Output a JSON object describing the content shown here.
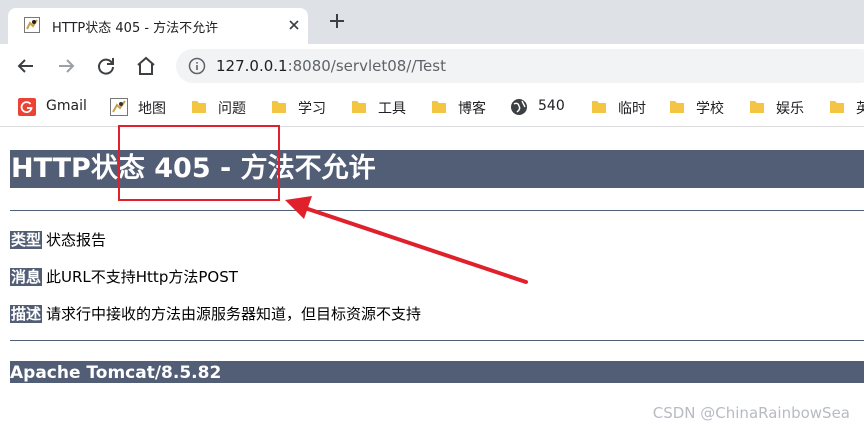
{
  "tab": {
    "title": "HTTP状态 405 - 方法不允许",
    "favicon": "tomcat-icon"
  },
  "toolbar": {
    "url_host": "127.0.0.1",
    "url_rest": ":8080/servlet08//Test",
    "icons": [
      "back-icon",
      "forward-icon",
      "reload-icon",
      "home-icon",
      "info-icon"
    ]
  },
  "bookmarks": [
    {
      "label": "Gmail",
      "icon": "gmail-icon"
    },
    {
      "label": "地图",
      "icon": "map-icon"
    },
    {
      "label": "问题",
      "icon": "folder-icon"
    },
    {
      "label": "学习",
      "icon": "folder-icon"
    },
    {
      "label": "工具",
      "icon": "folder-icon"
    },
    {
      "label": "博客",
      "icon": "folder-icon"
    },
    {
      "label": "540",
      "icon": "globe-icon"
    },
    {
      "label": "临时",
      "icon": "folder-icon"
    },
    {
      "label": "学校",
      "icon": "folder-icon"
    },
    {
      "label": "娱乐",
      "icon": "folder-icon"
    },
    {
      "label": "英",
      "icon": "folder-icon"
    }
  ],
  "page": {
    "title": "HTTP状态 405 - 方法不允许",
    "type_label": "类型",
    "type_value": "状态报告",
    "message_label": "消息",
    "message_value": "此URL不支持Http方法POST",
    "desc_label": "描述",
    "desc_value": "请求行中接收的方法由源服务器知道，但目标资源不支持",
    "footer": "Apache Tomcat/8.5.82"
  },
  "watermark": "CSDN @ChinaRainbowSea",
  "colors": {
    "header_bar": "#525d76",
    "annotation": "#e0202a",
    "tabstrip": "#dee1e6"
  }
}
